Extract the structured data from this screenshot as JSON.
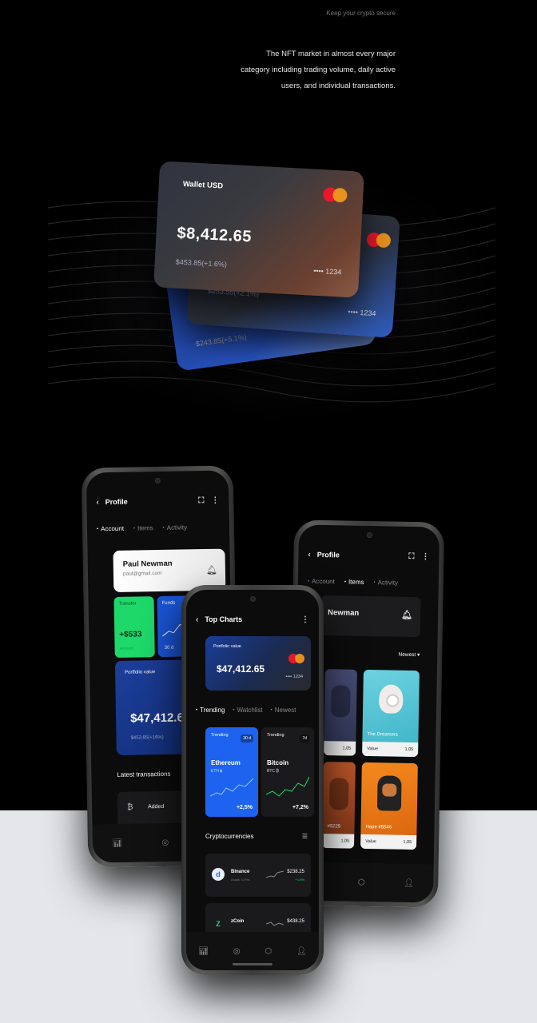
{
  "header": {
    "tagline": "Keep your crypto secure",
    "intro": "The NFT market in almost every major category including trading volume, daily active users, and individual transactions."
  },
  "cards": {
    "front": {
      "title": "Wallet USD",
      "amount": "$8,412.65",
      "change": "$453.85(+1.6%)",
      "number": "•••• 1234"
    },
    "middle": {
      "change": "$253.55(+2.1%)",
      "number": "•••• 1234"
    },
    "back": {
      "change": "$243.85(+5.1%)"
    }
  },
  "phone_left": {
    "title": "Profile",
    "tabs": [
      "Account",
      "Items",
      "Activity"
    ],
    "user_name": "Paul Newman",
    "user_email": "paul@gmail.com",
    "transfer_label": "Transfer",
    "transfer_value": "+$533",
    "transfer_sub": "Amount",
    "funds_label": "Funds",
    "funds_sub": "30 d",
    "portfolio_label": "Portfolio value",
    "portfolio_value": "$47,412.65",
    "portfolio_change": "$453.85(+16%)",
    "latest_title": "Latest transactions",
    "tx_label": "Added"
  },
  "phone_right": {
    "title": "Profile",
    "tabs": [
      "Account",
      "Items",
      "Activity"
    ],
    "user_name": "Newman",
    "sort": "Newest",
    "nfts": [
      {
        "name": "",
        "value_label": "",
        "value": "1,05"
      },
      {
        "name": "The Dreamers",
        "value_label": "Value",
        "value": "1,05"
      },
      {
        "name": "#5225",
        "value_label": "",
        "value": "1,05"
      },
      {
        "name": "Hape #5546",
        "value_label": "Value",
        "value": "1,05"
      }
    ]
  },
  "phone_center": {
    "title": "Top Charts",
    "portfolio_label": "Portfolio value",
    "portfolio_value": "$47,412.65",
    "card_number": "•••• 1234",
    "tabs": [
      "Trending",
      "Watchlist",
      "Newest"
    ],
    "trending": [
      {
        "label": "Trending",
        "period": "30 d",
        "name": "Ethereum",
        "symbol": "ETH ⧫",
        "change": "+2,5%"
      },
      {
        "label": "Trending",
        "period": "7d",
        "name": "Bitcoin",
        "symbol": "BTC ₿",
        "change": "+7,2%"
      }
    ],
    "crypto_title": "Cryptocurrencies",
    "coins": [
      {
        "logo": "d",
        "name": "Binance",
        "sub": "Anadk 3.4%s",
        "price": "$238.25",
        "change": "+1.8%"
      },
      {
        "logo": "Z",
        "name": "zCoin",
        "sub": "",
        "price": "$438.25",
        "change": ""
      }
    ]
  },
  "colors": {
    "green": "#1ed96a",
    "blue": "#1d63f0",
    "mastercard_red": "#e9172b",
    "mastercard_yellow": "#f49a1c"
  }
}
